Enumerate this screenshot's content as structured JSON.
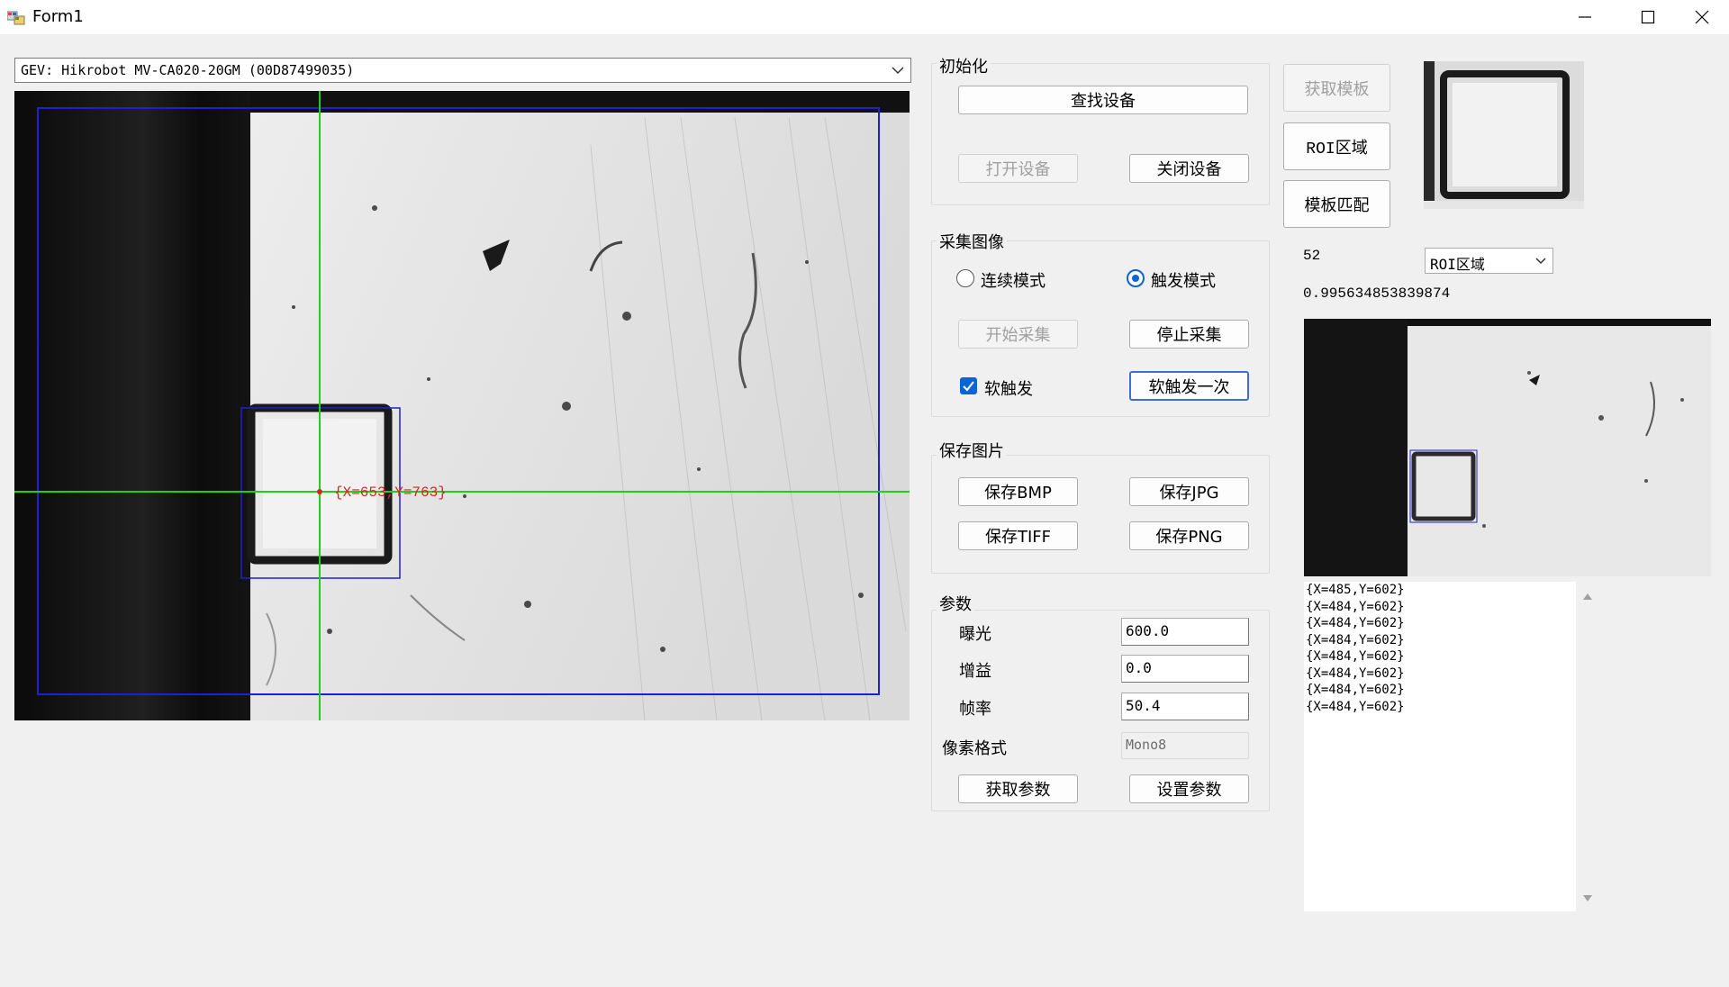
{
  "window": {
    "title": "Form1"
  },
  "device": {
    "selected": "GEV: Hikrobot MV-CA020-20GM (00D87499035)"
  },
  "camera_view": {
    "crosshair_label": "{X=653,Y=763}"
  },
  "init_group": {
    "title": "初始化",
    "find_label": "查找设备",
    "open_label": "打开设备",
    "close_label": "关闭设备"
  },
  "capture_group": {
    "title": "采集图像",
    "continuous_label": "连续模式",
    "trigger_label": "触发模式",
    "selected_mode": "trigger",
    "start_label": "开始采集",
    "stop_label": "停止采集",
    "soft_trigger_label": "软触发",
    "soft_trigger_checked": true,
    "soft_trigger_once_label": "软触发一次"
  },
  "save_group": {
    "title": "保存图片",
    "bmp_label": "保存BMP",
    "jpg_label": "保存JPG",
    "tiff_label": "保存TIFF",
    "png_label": "保存PNG"
  },
  "params_group": {
    "title": "参数",
    "exposure_label": "曝光",
    "exposure_value": "600.0",
    "gain_label": "增益",
    "gain_value": "0.0",
    "framerate_label": "帧率",
    "framerate_value": "50.4",
    "pixel_format_label": "像素格式",
    "pixel_format_value": "Mono8",
    "get_label": "获取参数",
    "set_label": "设置参数"
  },
  "template": {
    "get_template_label": "获取模板",
    "roi_label": "ROI区域",
    "match_label": "模板匹配",
    "count": "52",
    "score": "0.995634853839874",
    "roi_select": "ROI区域"
  },
  "coords": [
    "{X=485,Y=602}",
    "{X=484,Y=602}",
    "{X=484,Y=602}",
    "{X=484,Y=602}",
    "{X=484,Y=602}",
    "{X=484,Y=602}",
    "{X=484,Y=602}",
    "{X=484,Y=602}"
  ],
  "colors": {
    "accent": "#0a64d8",
    "roi": "#2020d0",
    "crosshair": "#22cc22",
    "marker": "#e02020"
  }
}
